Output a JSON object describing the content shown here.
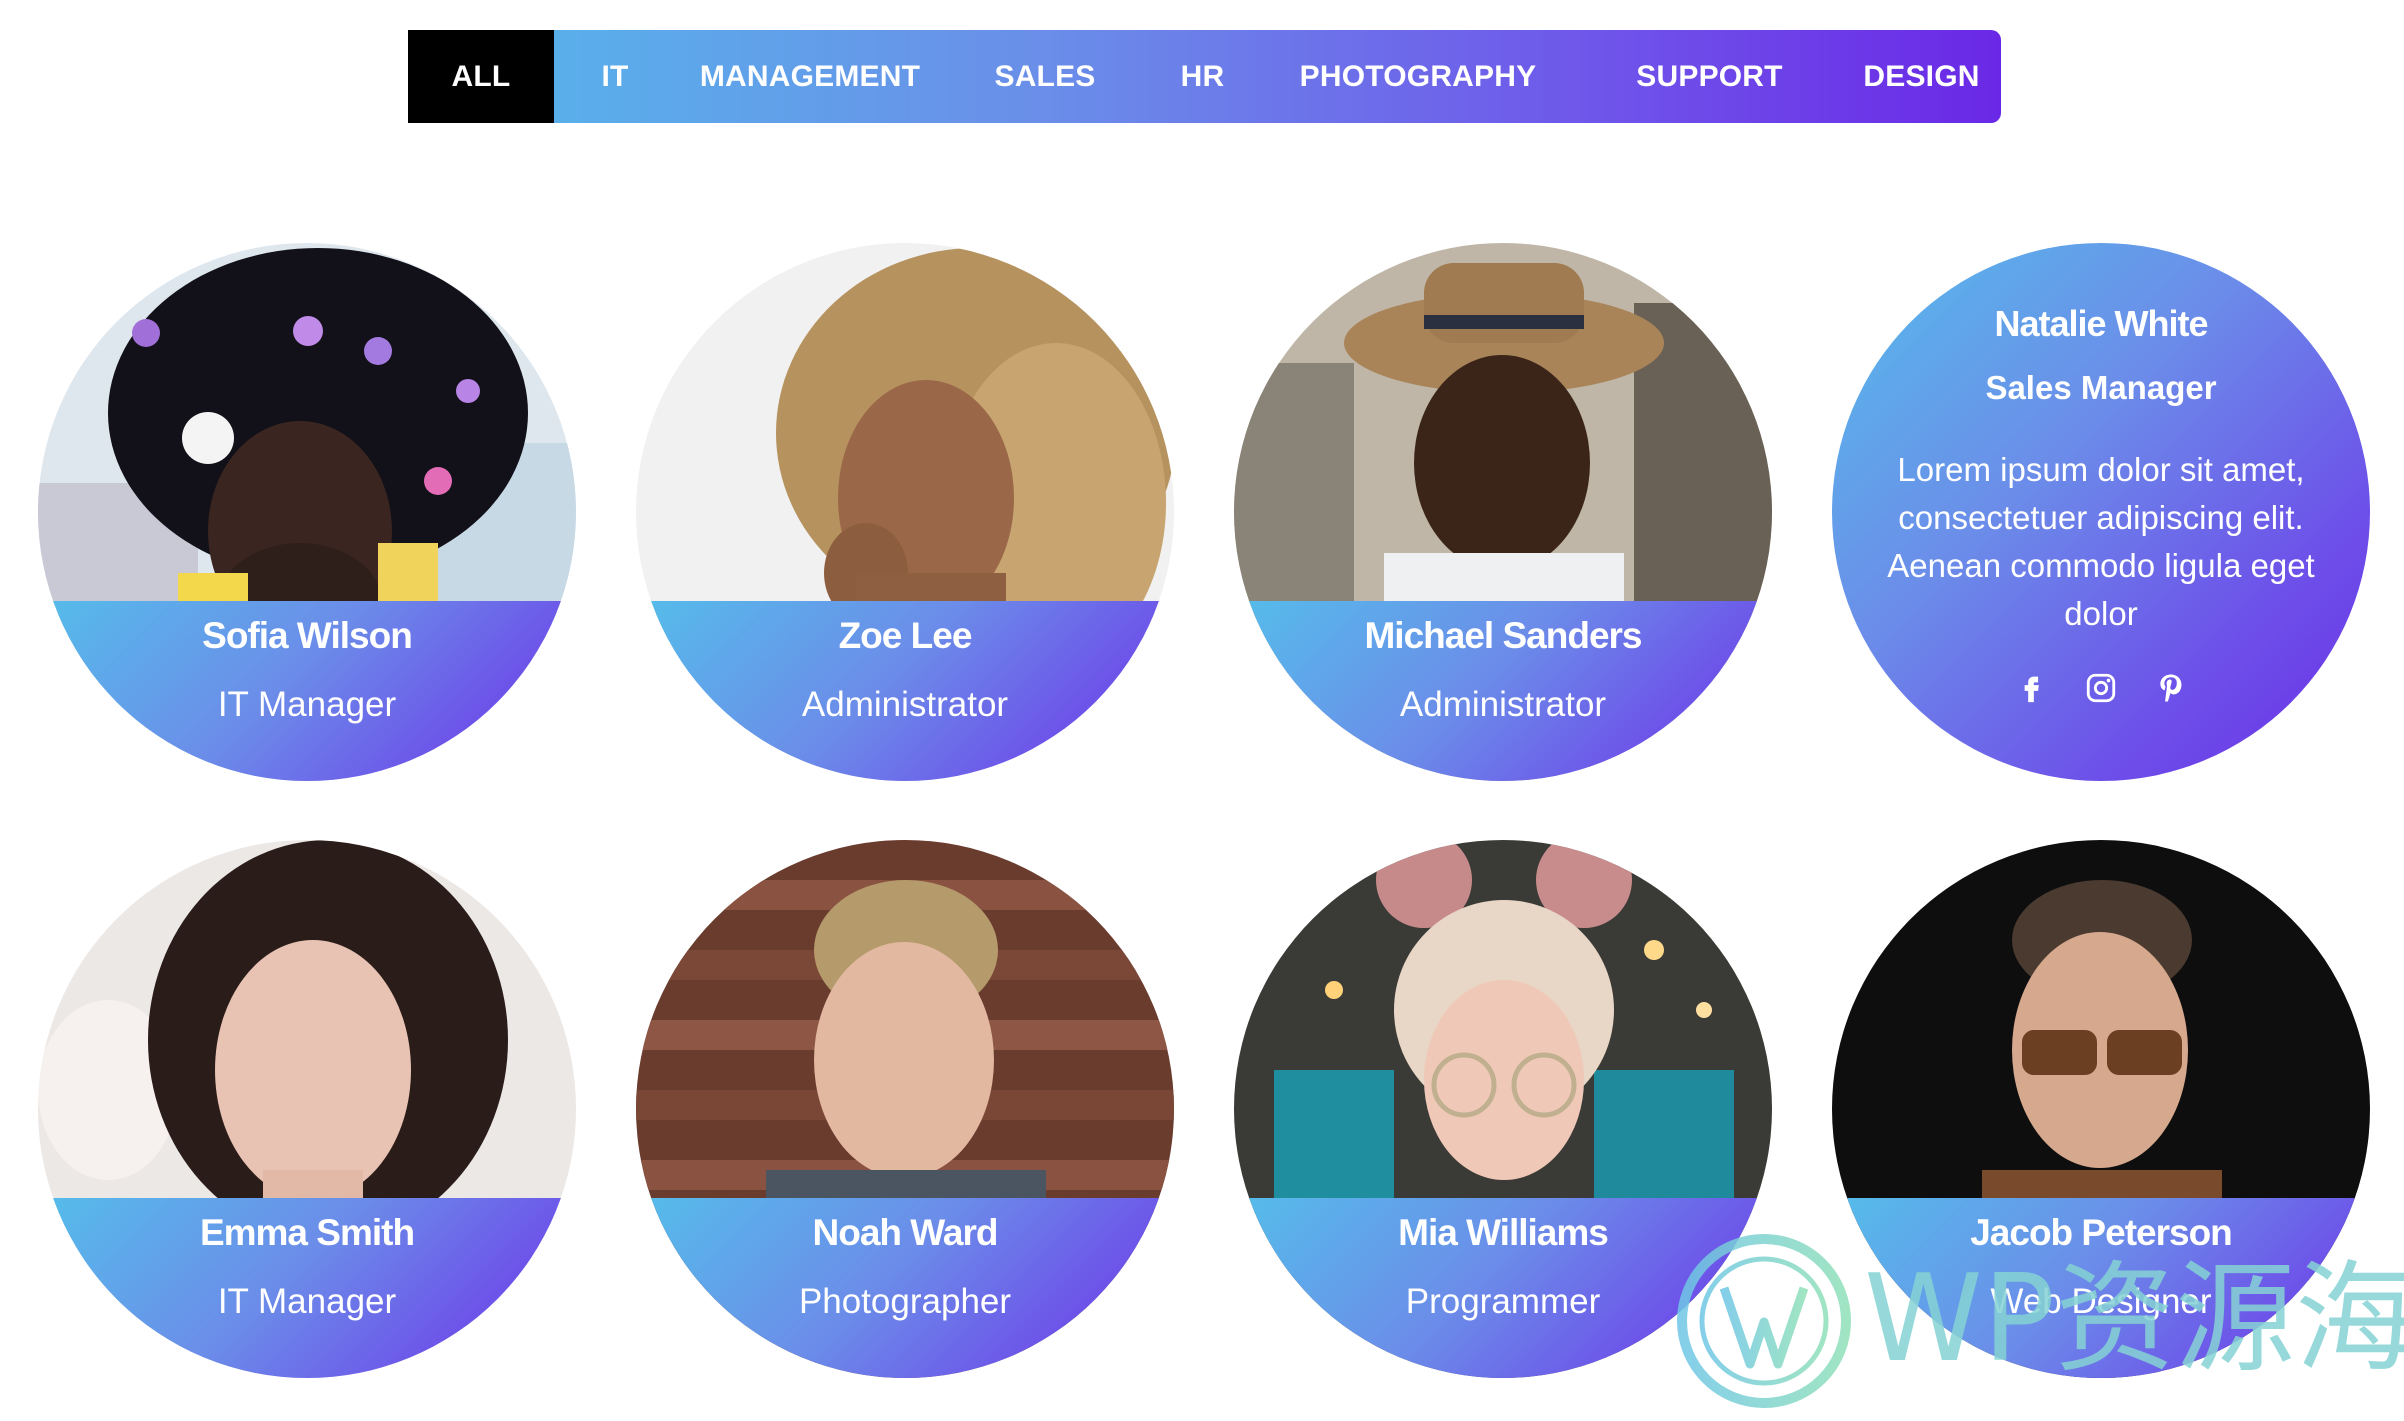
{
  "filters": [
    "ALL",
    "IT",
    "MANAGEMENT",
    "SALES",
    "HR",
    "PHOTOGRAPHY",
    "SUPPORT",
    "DESIGN"
  ],
  "members": [
    {
      "name": "Sofia Wilson",
      "role": "IT Manager"
    },
    {
      "name": "Zoe Lee",
      "role": "Administrator"
    },
    {
      "name": "Michael Sanders",
      "role": "Administrator"
    },
    {
      "name": "Emma Smith",
      "role": "IT Manager"
    },
    {
      "name": "Noah Ward",
      "role": "Photographer"
    },
    {
      "name": "Mia Williams",
      "role": "Programmer"
    },
    {
      "name": "Jacob Peterson",
      "role": "Web Designer"
    }
  ],
  "featured": {
    "name": "Natalie White",
    "role": "Sales Manager",
    "bio": "Lorem ipsum dolor sit amet, consectetuer adipiscing elit. Aenean commodo ligula eget dolor",
    "social_icons": [
      "facebook-icon",
      "instagram-icon",
      "pinterest-icon"
    ]
  },
  "watermark": {
    "text": "WP资源海"
  },
  "colors": {
    "gradient_start": "#54b9ea",
    "gradient_end": "#6a28e6",
    "active_tab": "#000000",
    "text": "#ffffff"
  }
}
